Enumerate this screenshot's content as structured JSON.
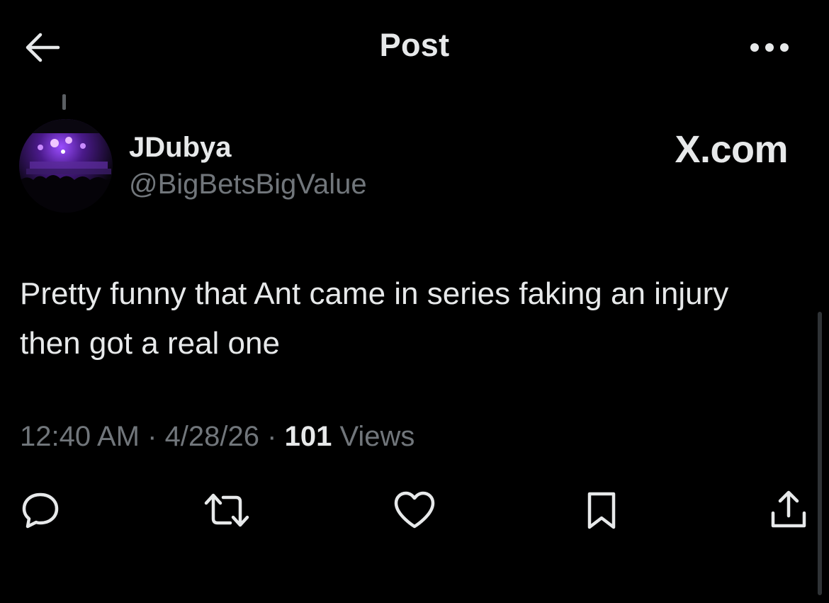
{
  "header": {
    "title": "Post",
    "back_icon": "arrow-left-icon",
    "more_icon": "more-horizontal-icon"
  },
  "author": {
    "name": "JDubya",
    "handle": "@BigBetsBigValue",
    "avatar_icon": "concert-avatar-image"
  },
  "source_label": "X.com",
  "tweet": {
    "text": "Pretty funny that Ant came in series faking an injury then got a real one"
  },
  "meta": {
    "time": "12:40 AM",
    "sep1": " · ",
    "date": "4/28/26",
    "sep2": " · ",
    "views_count": "101",
    "views_label": " Views"
  },
  "actions": [
    {
      "name": "reply",
      "icon": "reply-icon"
    },
    {
      "name": "repost",
      "icon": "repost-icon"
    },
    {
      "name": "like",
      "icon": "heart-icon"
    },
    {
      "name": "bookmark",
      "icon": "bookmark-icon"
    },
    {
      "name": "share",
      "icon": "share-icon"
    }
  ],
  "colors": {
    "background": "#000000",
    "primary_text": "#e7e9ea",
    "secondary_text": "#71767b",
    "icon": "#e7e9ea"
  }
}
